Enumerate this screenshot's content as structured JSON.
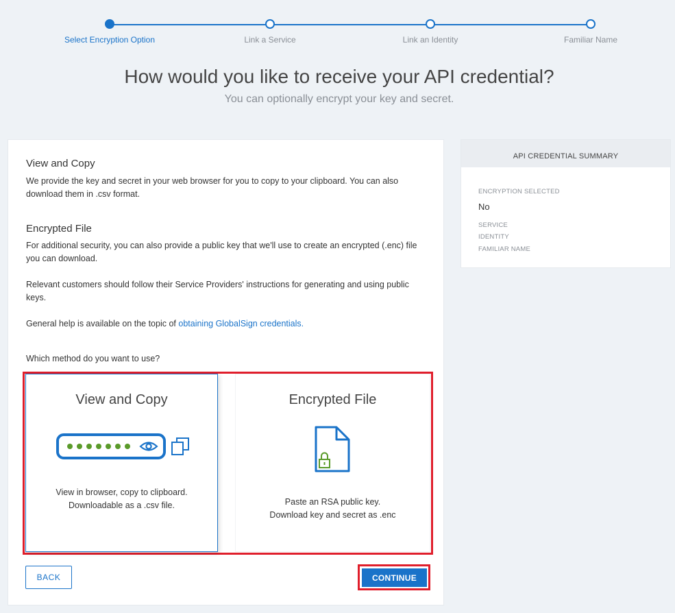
{
  "stepper": {
    "steps": [
      {
        "label": "Select Encryption Option"
      },
      {
        "label": "Link a Service"
      },
      {
        "label": "Link an Identity"
      },
      {
        "label": "Familiar Name"
      }
    ]
  },
  "heading": {
    "title": "How would you like to receive your API credential?",
    "subtitle": "You can optionally encrypt your key and secret."
  },
  "content": {
    "view_copy_title": "View and Copy",
    "view_copy_text": "We provide the key and secret in your web browser for you to copy to your clipboard. You can also download them in .csv format.",
    "encrypted_title": "Encrypted File",
    "encrypted_text": "For additional security, you can also provide a public key that we'll use to create an encrypted (.enc) file you can download.",
    "relevant_text": "Relevant customers should follow their Service Providers' instructions for generating and using public keys.",
    "help_prefix": "General help is available on the topic of ",
    "help_link": "obtaining GlobalSign credentials.",
    "method_question": "Which method do you want to use?"
  },
  "options": {
    "view": {
      "title": "View and Copy",
      "desc1": "View in browser, copy to clipboard.",
      "desc2": "Downloadable as a .csv file."
    },
    "encrypted": {
      "title": "Encrypted File",
      "desc1": "Paste an RSA public key.",
      "desc2": "Download key and secret as .enc"
    }
  },
  "buttons": {
    "back": "BACK",
    "continue": "CONTINUE"
  },
  "summary": {
    "title": "API CREDENTIAL SUMMARY",
    "encryption_label": "ENCRYPTION SELECTED",
    "encryption_value": "No",
    "service_label": "SERVICE",
    "identity_label": "IDENTITY",
    "familiar_label": "FAMILIAR NAME"
  },
  "colors": {
    "accent": "#1a73c9",
    "highlight": "#e01e2b",
    "green": "#5a9a2a"
  }
}
